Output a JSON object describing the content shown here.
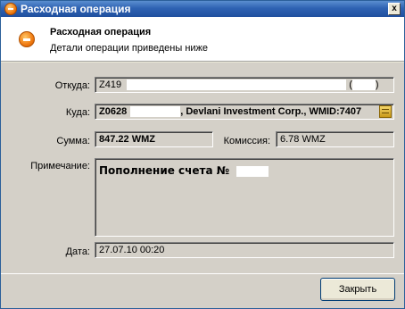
{
  "window": {
    "title": "Расходная операция",
    "close_glyph": "x"
  },
  "header": {
    "title": "Расходная операция",
    "subtitle": "Детали операции приведены ниже",
    "icon": "minus-circle-icon"
  },
  "form": {
    "from_label": "Откуда:",
    "from_value": "Z419",
    "from_paren_open": "(",
    "from_paren_close": ")",
    "to_label": "Куда:",
    "to_value_start": "Z0628",
    "to_value_end": ", Devlani Investment Corp., WMID:7407",
    "amount_label": "Сумма:",
    "amount_value": "847.22 WMZ",
    "commission_label": "Комиссия:",
    "commission_value": "6.78 WMZ",
    "note_label": "Примечание:",
    "note_value": "Пополнение счета №",
    "date_label": "Дата:",
    "date_value": "27.07.10 00:20"
  },
  "footer": {
    "close_label": "Закрыть"
  }
}
